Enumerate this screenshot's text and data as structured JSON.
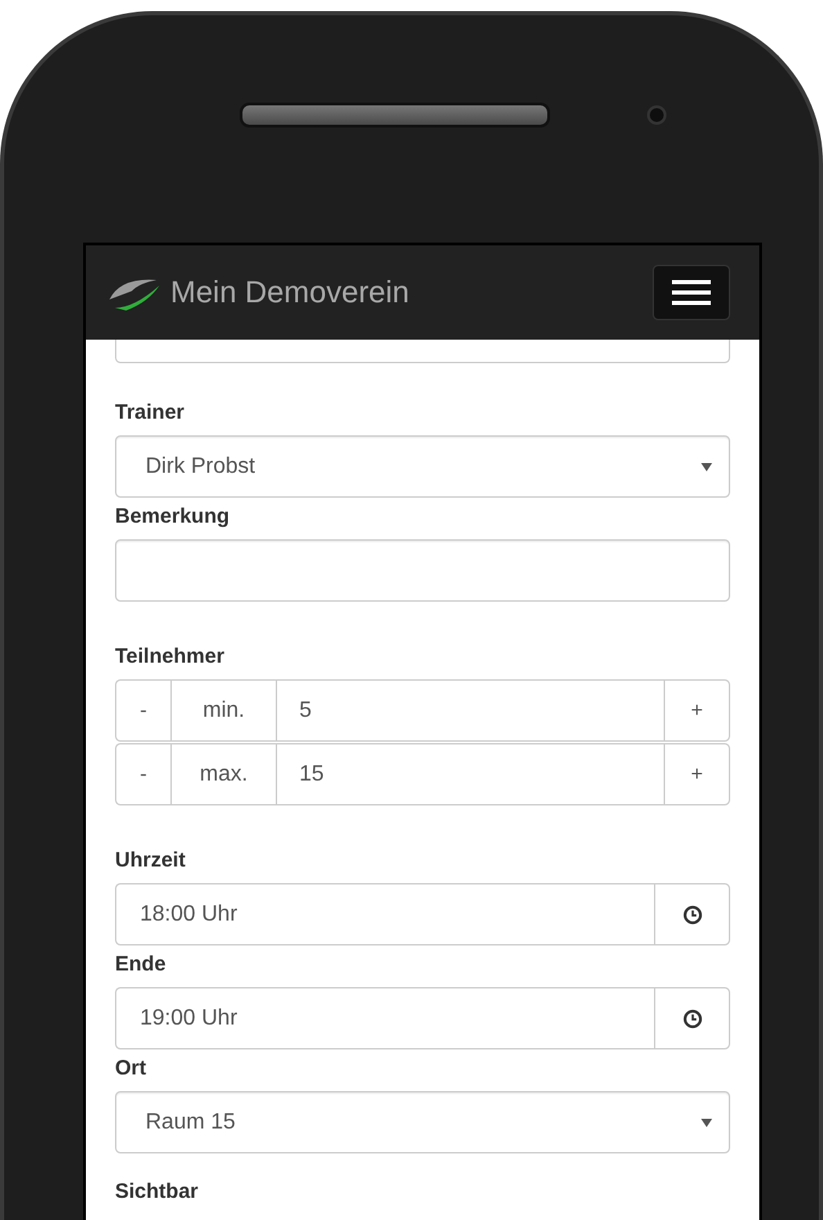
{
  "navbar": {
    "brand": "Mein Demoverein"
  },
  "form": [
    {
      "kind": "partial"
    },
    {
      "kind": "select",
      "label": "Trainer",
      "value": "Dirk Probst"
    },
    {
      "kind": "text",
      "label": "Bemerkung"
    },
    {
      "kind": "spinners",
      "label": "Teilnehmer",
      "rows": [
        {
          "minus": "-",
          "addon": "min.",
          "value": "5",
          "plus": "+"
        },
        {
          "minus": "-",
          "addon": "max.",
          "value": "15",
          "plus": "+"
        }
      ]
    },
    {
      "kind": "time",
      "label": "Uhrzeit",
      "value": "18:00 Uhr"
    },
    {
      "kind": "time",
      "label": "Ende",
      "value": "19:00 Uhr"
    },
    {
      "kind": "select",
      "label": "Ort",
      "value": "Raum 15"
    },
    {
      "kind": "heading",
      "label": "Sichtbar"
    }
  ]
}
